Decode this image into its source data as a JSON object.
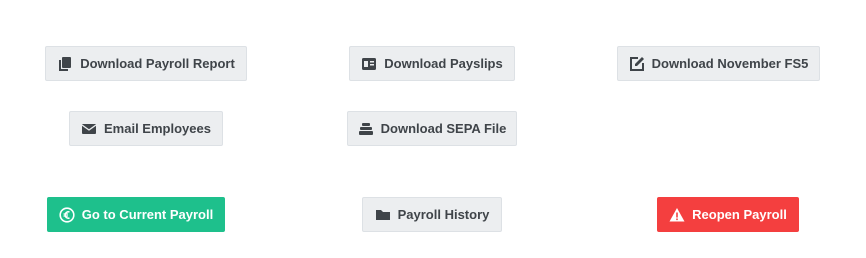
{
  "actions": {
    "download_payroll_report": {
      "label": "Download Payroll Report",
      "icon": "copy-icon"
    },
    "download_payslips": {
      "label": "Download Payslips",
      "icon": "id-card-icon"
    },
    "download_fs5": {
      "label": "Download November FS5",
      "icon": "edit-icon"
    },
    "email_employees": {
      "label": "Email Employees",
      "icon": "envelope-icon"
    },
    "download_sepa": {
      "label": "Download SEPA File",
      "icon": "stack-icon"
    },
    "current_payroll": {
      "label": "Go to Current Payroll",
      "icon": "euro-circle-icon"
    },
    "payroll_history": {
      "label": "Payroll History",
      "icon": "folder-icon"
    },
    "reopen_payroll": {
      "label": "Reopen Payroll",
      "icon": "warning-icon"
    }
  },
  "colors": {
    "light_button_bg": "#eceef0",
    "light_button_text": "#3f4449",
    "primary_green": "#1ec08c",
    "danger_red": "#f43f3f"
  }
}
